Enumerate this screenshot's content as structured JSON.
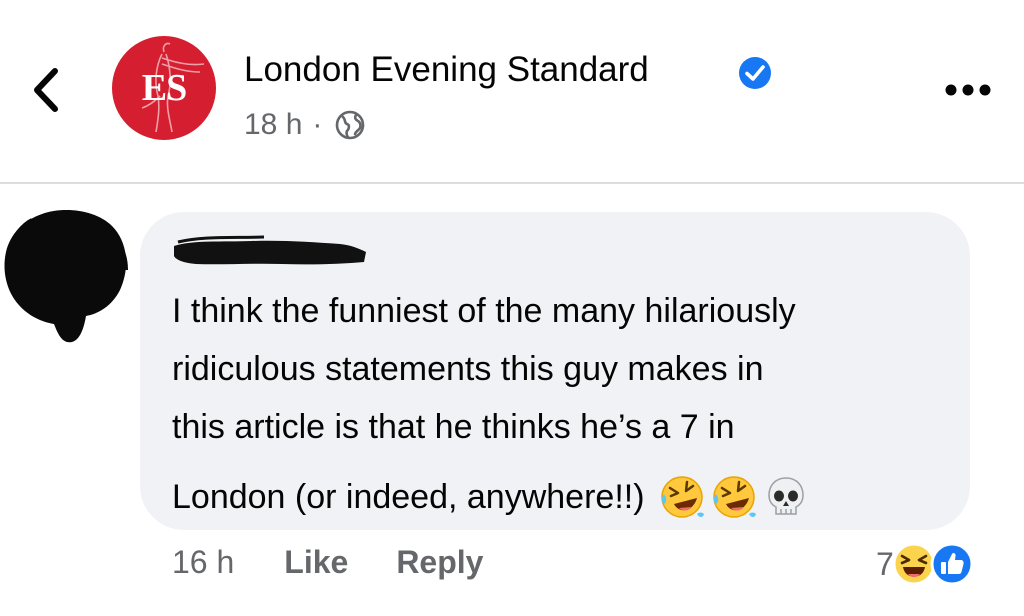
{
  "post": {
    "page_name": "London Evening Standard",
    "avatar_letters": "ES",
    "time": "18 h",
    "separator": "·",
    "verified_icon": "verified-badge-icon",
    "privacy_icon": "globe-icon"
  },
  "comment": {
    "lines": [
      "I think the funniest of the many hilariously",
      "ridiculous statements this guy makes in",
      "this article is that he thinks he’s a 7 in",
      "London (or indeed, anywhere!!)"
    ],
    "emojis": [
      "rolling-on-floor-laughing",
      "rolling-on-floor-laughing",
      "skull"
    ],
    "time": "16 h",
    "like_label": "Like",
    "reply_label": "Reply",
    "reaction_count": "7",
    "reaction_icons": [
      "laughing-reaction-icon",
      "like-reaction-icon"
    ]
  },
  "colors": {
    "brand_red": "#d51f30",
    "verified_blue": "#1877f2",
    "bubble_bg": "#f0f2f5",
    "meta_gray": "#65676b"
  }
}
